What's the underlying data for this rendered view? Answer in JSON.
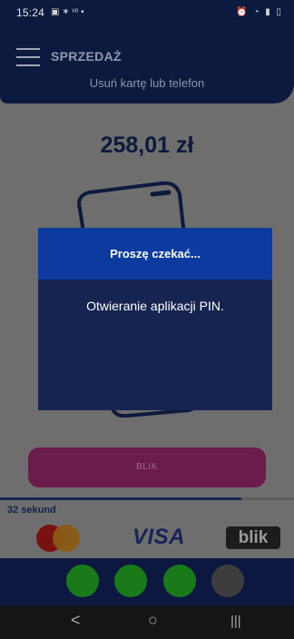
{
  "status_bar": {
    "time": "15:24",
    "left_icons": "▣ ✶ ᵛᵒ •",
    "right_icons": "⏰ ◔ ▮ ▯"
  },
  "header": {
    "title": "SPRZEDAŻ",
    "subtitle": "Usuń kartę lub telefon"
  },
  "main": {
    "amount": "258,01 zł",
    "blik_button_label": "BLIK",
    "progress_fraction": 0.82,
    "countdown": "32 sekund"
  },
  "brands": {
    "visa": "VISA",
    "blik": "blik"
  },
  "pin_dots": [
    {
      "color": "#1a7a1a"
    },
    {
      "color": "#1a7a1a"
    },
    {
      "color": "#1a7a1a"
    },
    {
      "color": "#3d3d3d"
    }
  ],
  "dialog": {
    "title": "Proszę czekać...",
    "message": "Otwieranie aplikacji PIN."
  },
  "navbar": {
    "back": "<",
    "home": "○",
    "recents": "|||"
  },
  "colors": {
    "navy": "#0b1a3e",
    "dialog_header": "#0d3a9e",
    "dialog_body": "#162451",
    "blik_button": "#6a1c4c"
  }
}
